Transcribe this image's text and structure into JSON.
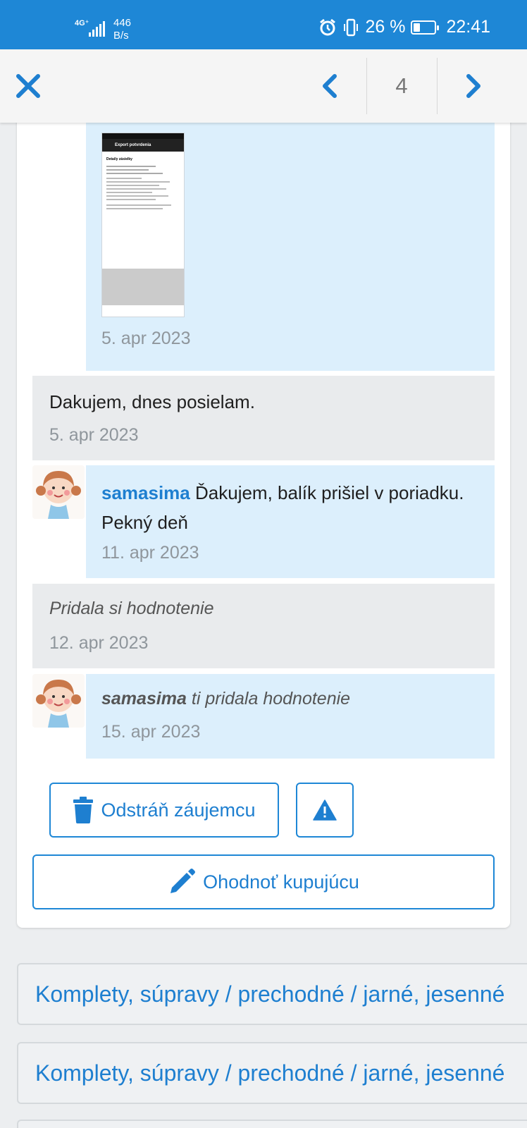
{
  "status_bar": {
    "network": "4G⁺",
    "speed_value": "446",
    "speed_unit": "B/s",
    "battery": "26 %",
    "time": "22:41"
  },
  "nav": {
    "page_number": "4"
  },
  "messages": [
    {
      "type": "image",
      "date": "5. apr 2023"
    },
    {
      "type": "text",
      "text": "Dakujem, dnes posielam.",
      "date": "5. apr 2023"
    },
    {
      "type": "user",
      "user": "samasima",
      "text": "Ďakujem, balík prišiel v poriadku. Pekný deň",
      "date": "11. apr 2023"
    },
    {
      "type": "event",
      "prefix": "Pridala si",
      "link": "hodnotenie",
      "date": "12. apr 2023"
    },
    {
      "type": "user-event",
      "user": "samasima",
      "middle": "ti pridala",
      "link": "hodnotenie",
      "date": "15. apr 2023"
    }
  ],
  "thumbnail": {
    "header": "Export potvrdenia",
    "title": "Detaily zásielky"
  },
  "actions": {
    "remove_label": "Odstráň záujemcu",
    "rate_label": "Ohodnoť kupujúcu"
  },
  "listings": [
    "Komplety, súpravy / prechodné / jarné, jesenné",
    "Komplety, súpravy / prechodné / jarné, jesenné"
  ],
  "colors": {
    "accent": "#1e87d6",
    "bubble_blue": "#dceffc",
    "bubble_grey": "#e9ebed"
  }
}
